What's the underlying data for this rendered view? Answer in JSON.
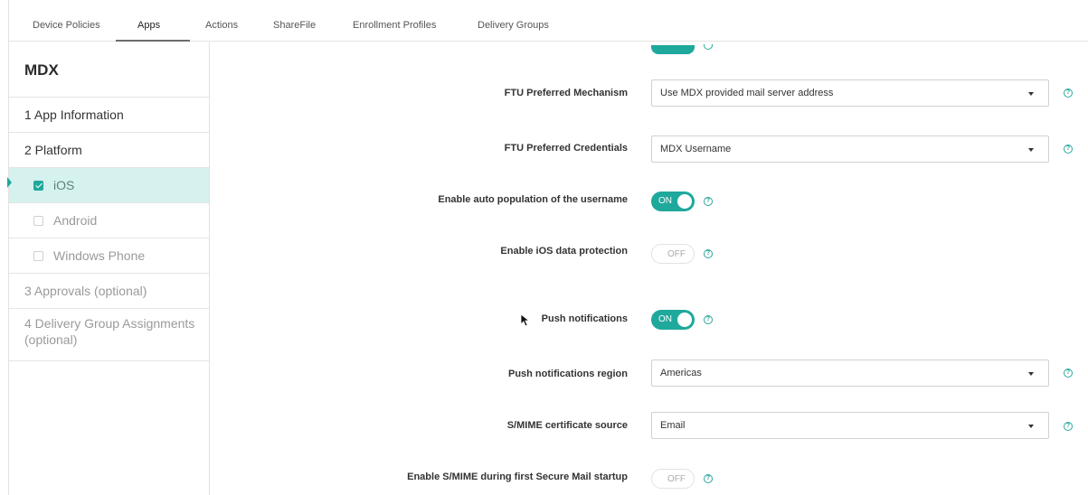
{
  "tabs": [
    {
      "label": "Device Policies"
    },
    {
      "label": "Apps"
    },
    {
      "label": "Actions"
    },
    {
      "label": "ShareFile"
    },
    {
      "label": "Enrollment Profiles"
    },
    {
      "label": "Delivery Groups"
    }
  ],
  "sidebar": {
    "title": "MDX",
    "items": [
      {
        "label": "1 App Information"
      },
      {
        "label": "2 Platform"
      },
      {
        "label": "iOS",
        "checked": true
      },
      {
        "label": "Android",
        "checked": false
      },
      {
        "label": "Windows Phone",
        "checked": false
      },
      {
        "label": "3 Approvals (optional)"
      },
      {
        "label": "4 Delivery Group Assignments (optional)"
      }
    ]
  },
  "form": {
    "ftu_mechanism": {
      "label": "FTU Preferred Mechanism",
      "value": "Use MDX provided mail server address"
    },
    "ftu_credentials": {
      "label": "FTU Preferred Credentials",
      "value": "MDX Username"
    },
    "auto_population": {
      "label": "Enable auto population of the username",
      "state": "ON"
    },
    "ios_data_protection": {
      "label": "Enable iOS data protection",
      "state": "OFF"
    },
    "push_notifications": {
      "label": "Push notifications",
      "state": "ON"
    },
    "push_region": {
      "label": "Push notifications region",
      "value": "Americas"
    },
    "smime_source": {
      "label": "S/MIME certificate source",
      "value": "Email"
    },
    "smime_first_startup": {
      "label": "Enable S/MIME during first Secure Mail startup",
      "state": "OFF"
    }
  },
  "help_glyph": "?",
  "colors": {
    "accent": "#1fa89c",
    "active_row": "#d5f2ef"
  }
}
